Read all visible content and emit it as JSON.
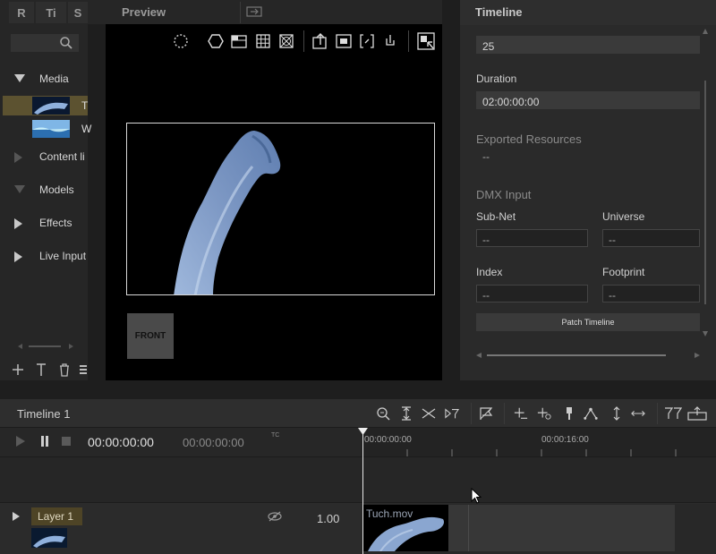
{
  "left_panel": {
    "tabs": [
      "R",
      "Ti",
      "S"
    ],
    "tree": [
      {
        "label": "Media",
        "state": "expanded"
      },
      {
        "label": "T",
        "kind": "thumb"
      },
      {
        "label": "W",
        "kind": "thumb"
      },
      {
        "label": "Content li",
        "state": "collapsed-dim"
      },
      {
        "label": "Models",
        "state": "expanded-dim"
      },
      {
        "label": "Effects",
        "state": "collapsed"
      },
      {
        "label": "Live Input",
        "state": "collapsed"
      }
    ]
  },
  "preview": {
    "title": "Preview",
    "front_label": "FRONT"
  },
  "inspector": {
    "title": "Timeline",
    "frame_rate": "25",
    "duration_label": "Duration",
    "duration_value": "02:00:00:00",
    "exported_label": "Exported Resources",
    "exported_value": "--",
    "dmx_label": "DMX Input",
    "subnet_label": "Sub-Net",
    "subnet_value": "--",
    "universe_label": "Universe",
    "universe_value": "--",
    "index_label": "Index",
    "index_value": "--",
    "footprint_label": "Footprint",
    "footprint_value": "--",
    "patch_button": "Patch Timeline"
  },
  "timeline": {
    "title": "Timeline 1",
    "timecode": "00:00:00:00",
    "timecode_secondary": "00:00:00:00",
    "tc_label": "TC",
    "ruler": [
      "00:00:00:00",
      "00:00:16:00"
    ],
    "layer": {
      "name": "Layer 1",
      "opacity": "1.00",
      "clip": "Tuch.mov"
    }
  },
  "colors": {
    "accent": "#5a4a2a",
    "selection": "#5c5230",
    "fabric": "#8aa6d0"
  }
}
